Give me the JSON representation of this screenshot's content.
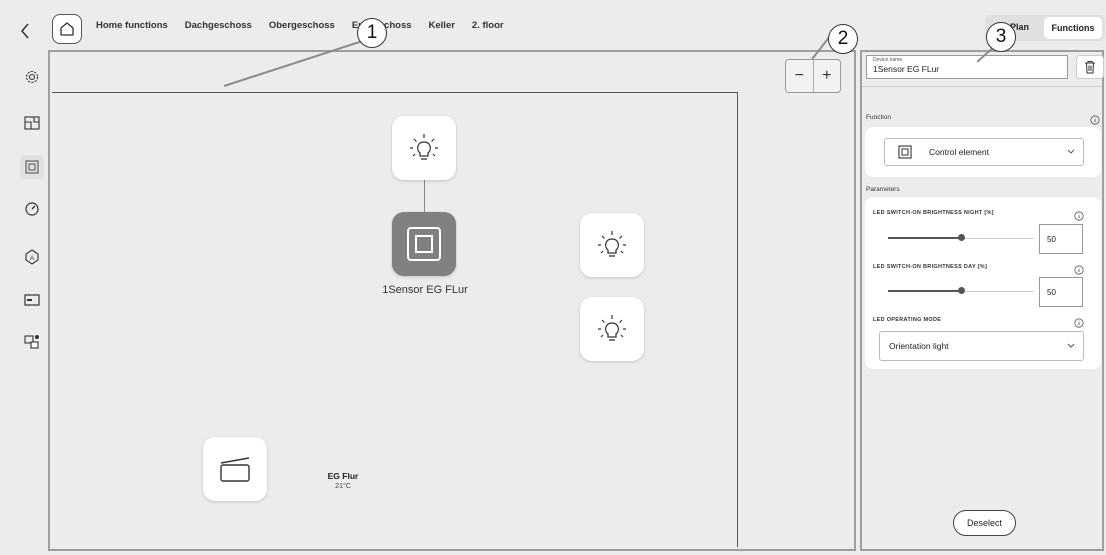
{
  "nav": {
    "back_icon": "chevron-left-icon",
    "home_icon": "house-icon",
    "tabs": [
      "Home functions",
      "Dachgeschoss",
      "Obergeschoss",
      "Erdgeschoss",
      "Keller",
      "2. floor"
    ]
  },
  "sidebar": {
    "icons": [
      "gear-icon",
      "floorplan-icon",
      "panel-icon",
      "gauge-icon",
      "automation-icon",
      "display-icon",
      "devices-icon"
    ],
    "active_index": 2
  },
  "canvas": {
    "zoom_out_label": "−",
    "zoom_in_label": "+",
    "selected_device_label": "1Sensor EG FLur",
    "room_name": "EG Flur",
    "room_temp": "21°C"
  },
  "view_tabs": {
    "plan": "Plan",
    "functions": "Functions",
    "active": "functions"
  },
  "panel": {
    "device_name_label": "Device name",
    "device_name_value": "1Sensor EG FLur",
    "function_title": "Function",
    "function_value": "Control element",
    "parameters_title": "Parameters",
    "params": [
      {
        "label": "LED SWITCH-ON BRIGHTNESS NIGHT [%]",
        "value": "50",
        "level": 0.5
      },
      {
        "label": "LED SWITCH-ON BRIGHTNESS DAY [%]",
        "value": "50",
        "level": 0.5
      }
    ],
    "mode_label": "LED OPERATING MODE",
    "mode_value": "Orientation light",
    "deselect_label": "Deselect"
  },
  "callouts": [
    "1",
    "2",
    "3"
  ],
  "colors": {
    "selected_tile": "#808080",
    "background": "#ececec"
  }
}
